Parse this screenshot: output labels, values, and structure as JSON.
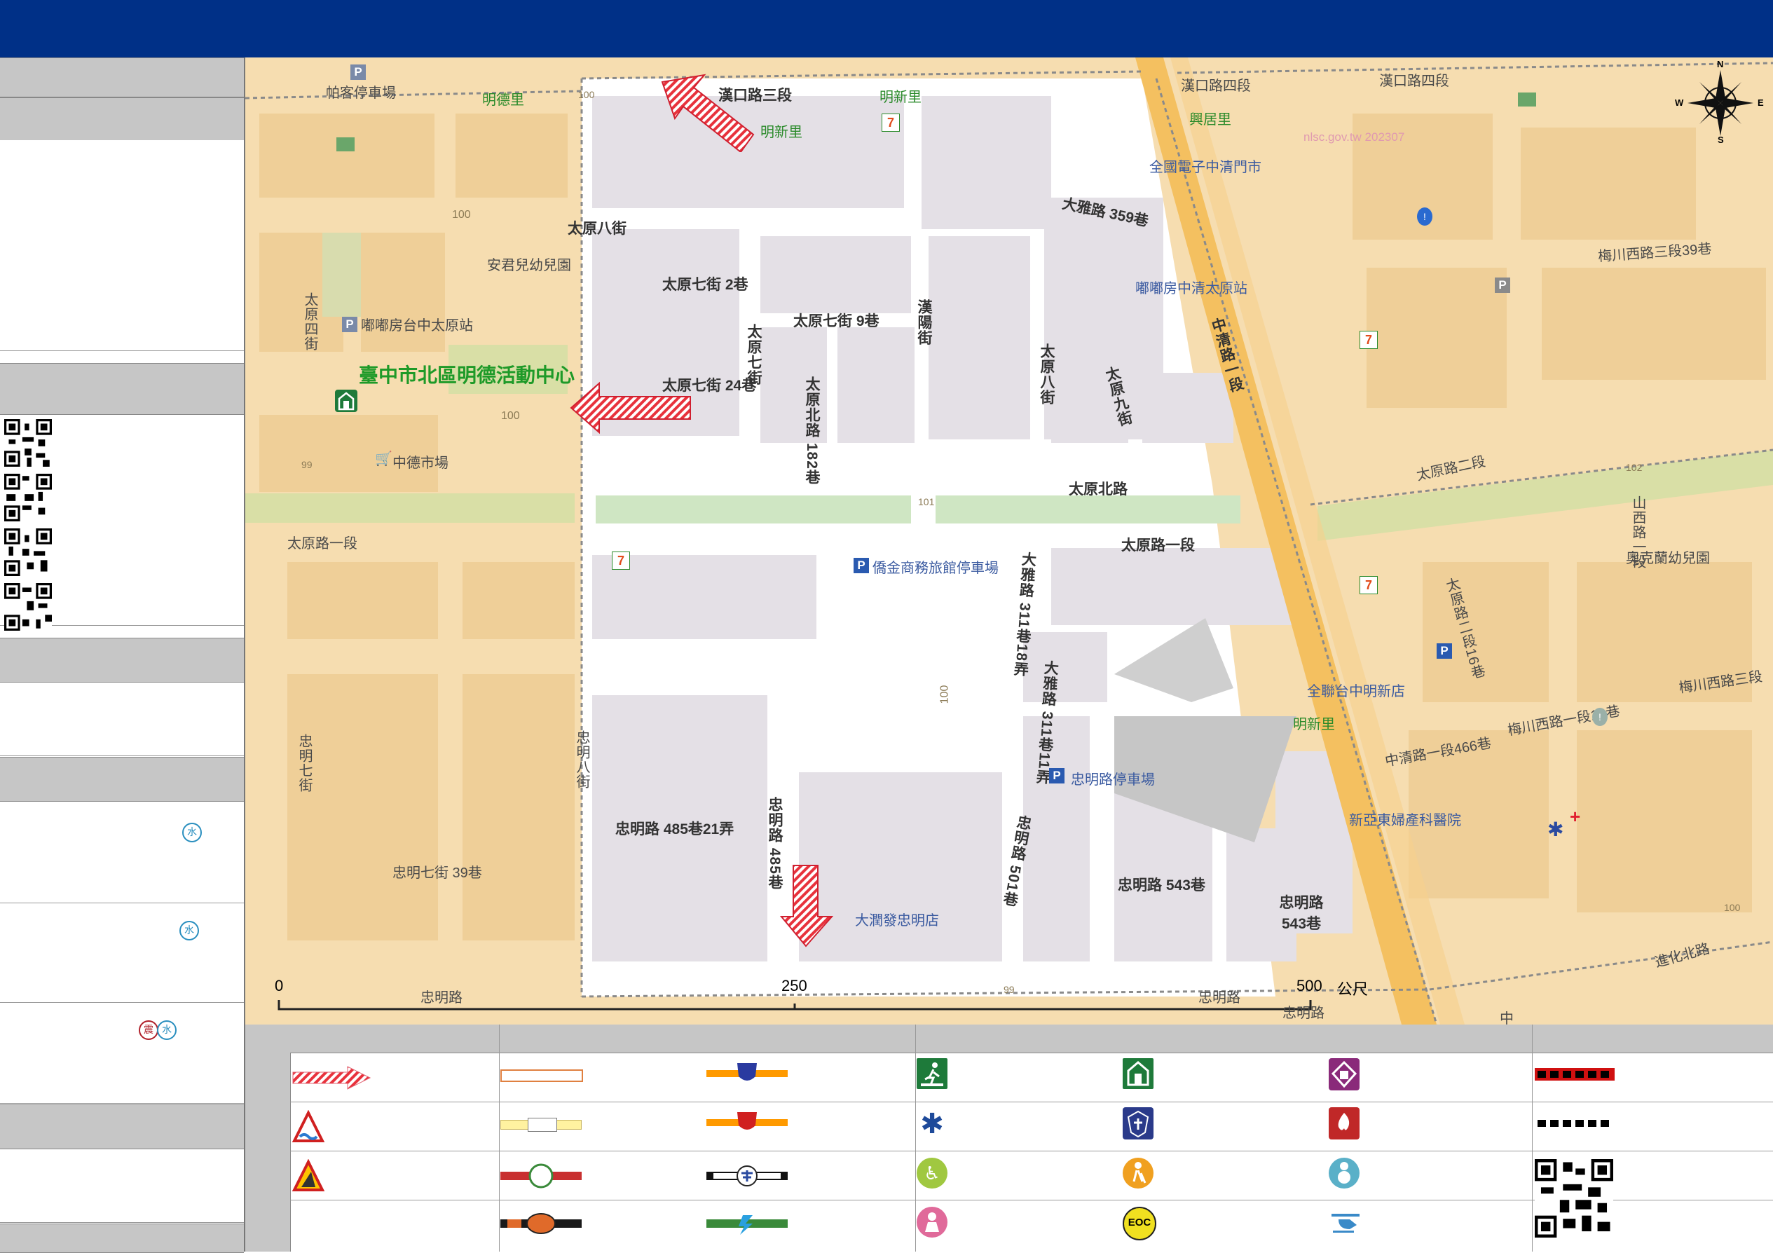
{
  "map": {
    "shelter_label": "臺中市北區明德活動中心",
    "watermark": "nlsc.gov.tw 202307",
    "scale": {
      "zero": "0",
      "mid": "250",
      "max": "500",
      "unit": "公尺"
    },
    "compass": {
      "n": "N",
      "s": "S",
      "e": "E",
      "w": "W"
    },
    "streets": {
      "hankou_3": "漢口路三段",
      "hankou_4": "漢口路四段",
      "hankou_4b": "漢口路四段",
      "taiyuan_8st": "太原八街",
      "taiyuan_7_2": "太原七街 2巷",
      "taiyuan_7_9": "太原七街 9巷",
      "taiyuan_7_24": "太原七街 24巷",
      "taiyuan_7st": "太原七街",
      "taiyuan_north_182": "太原北路 182巷",
      "hanyang": "漢陽街",
      "taiyuan_8v": "太原八街",
      "taiyuan_9": "太原九街",
      "daya_359": "大雅路 359巷",
      "zhongqing_1": "中清路一段",
      "taiyuan_north": "太原北路",
      "taiyuan_1": "太原路一段",
      "taiyuan_1_left": "太原路一段",
      "taiyuan_2": "太原路二段",
      "taiyuan_4st": "太原四街",
      "daya_311_18": "大雅路 311巷18弄",
      "daya_311_11": "大雅路 311巷11弄",
      "zhongming_485_21": "忠明路 485巷21弄",
      "zhongming_485": "忠明路 485巷",
      "zhongming_501": "忠明路 501巷",
      "zhongming_543": "忠明路 543巷",
      "zhongming_543b": "忠明路 543巷",
      "zhongming_7_39": "忠明七街 39巷",
      "zhongming_7st": "忠明七街",
      "zhongming_8st": "忠明八街",
      "zhongming": "忠明路",
      "zhongming_b": "忠明路",
      "zhongming_c": "忠明路",
      "meichuan_w3_39": "梅川西路三段39巷",
      "meichuan_w3": "梅川西路三段",
      "meichuan_w1_13": "梅川西路一段13巷",
      "zhongqing_1_466": "中清路一段466巷",
      "taiyuan_2_16": "太原路二段16巷",
      "shanxi_1": "山西路一段",
      "jinhua_north": "進化北路",
      "zhong": "中"
    },
    "places": {
      "pakeparking": "帕客停車場",
      "mingde_li": "明德里",
      "mingxin_li": "明新里",
      "mingxin_li2": "明新里",
      "mingxin_li3": "明新里",
      "xinghe_li": "興居里",
      "anjun_kg": "安君兒幼兒園",
      "dodohome_taiyuan": "嘟嘟房台中太原站",
      "zhongde_market": "中德市場",
      "quanguo_ev": "全國電子中清門市",
      "dodohome_zhongqing": "嘟嘟房中清太原站",
      "jinshang_parking": "僑金商務旅館停車場",
      "quanlian": "全聯台中明新店",
      "zhongming_parking": "忠明路停車場",
      "xinya_hospital": "新亞東婦產科醫院",
      "runtai": "大潤發忠明店",
      "aoke_kg": "奧克蘭幼兒園"
    },
    "contours": [
      "100",
      "100",
      "100",
      "99",
      "101",
      "102",
      "100",
      "99",
      "100"
    ]
  },
  "sidebar": {
    "hazard_water_1": "水",
    "hazard_water_2": "水",
    "hazard_quake": "震",
    "hazard_water_3": "水"
  },
  "legend": {
    "eoc_label": "EOC"
  }
}
